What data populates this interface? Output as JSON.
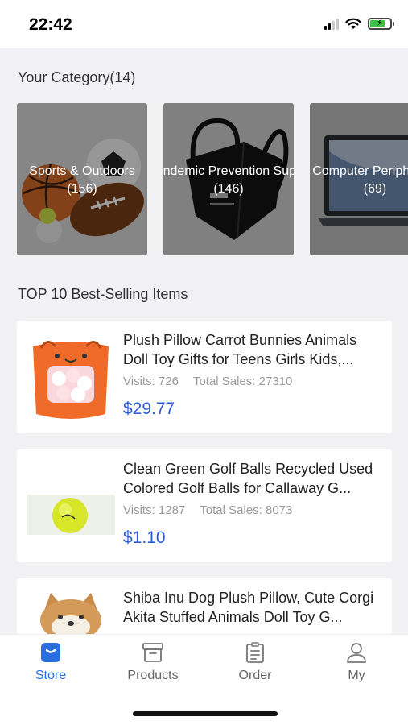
{
  "status_bar": {
    "time": "22:42"
  },
  "category_section": {
    "title": "Your Category(14)"
  },
  "categories": [
    {
      "name": "Sports & Outdoors",
      "count": "(156)",
      "icon": "sports-balls-image"
    },
    {
      "name": "Pandemic Prevention Supplies",
      "count": "(146)",
      "icon": "face-mask-image"
    },
    {
      "name": "Computer Peripherals",
      "count": "(69)",
      "icon": "laptop-image"
    }
  ],
  "best_selling": {
    "title": "TOP 10 Best-Selling Items"
  },
  "items": [
    {
      "title": "Plush Pillow Carrot Bunnies Animals Doll Toy Gifts for Teens Girls Kids,...",
      "visits": "Visits: 726",
      "sales": "Total Sales: 27310",
      "price": "$29.77",
      "icon": "carrot-plush-image"
    },
    {
      "title": "Clean Green Golf Balls Recycled Used Colored Golf Balls for Callaway G...",
      "visits": "Visits: 1287",
      "sales": "Total Sales: 8073",
      "price": "$1.10",
      "icon": "golf-ball-image"
    },
    {
      "title": "Shiba Inu Dog Plush Pillow, Cute Corgi Akita Stuffed Animals Doll Toy G...",
      "icon": "shiba-plush-image"
    }
  ],
  "tabs": [
    {
      "label": "Store",
      "icon": "store-bag-icon",
      "active": true
    },
    {
      "label": "Products",
      "icon": "archive-box-icon",
      "active": false
    },
    {
      "label": "Order",
      "icon": "clipboard-list-icon",
      "active": false
    },
    {
      "label": "My",
      "icon": "person-icon",
      "active": false
    }
  ],
  "colors": {
    "accent": "#2a6fe0",
    "price": "#2a5bd7",
    "background": "#f2f2f4"
  }
}
